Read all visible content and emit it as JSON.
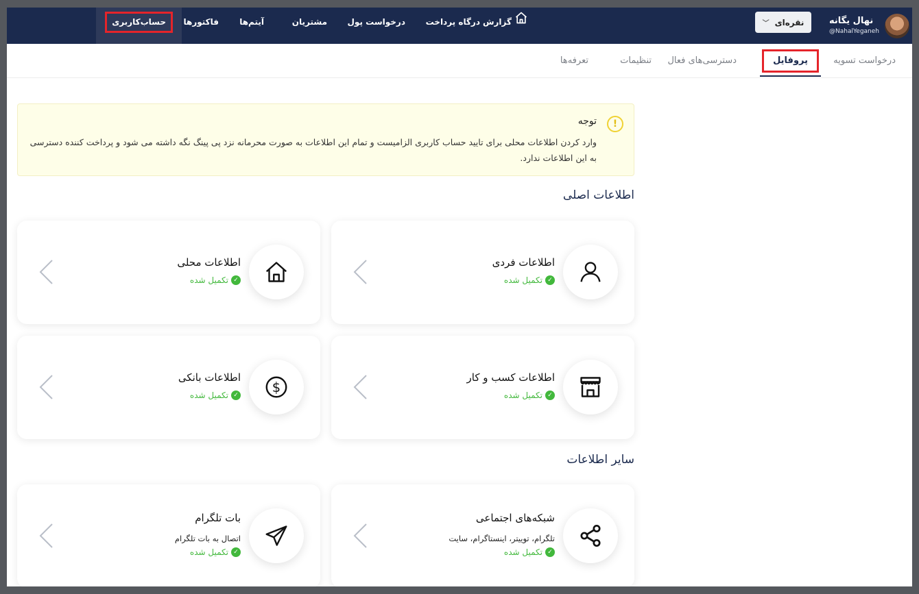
{
  "user": {
    "name": "نهال یگانه",
    "handle": "@NahalYeganeh"
  },
  "currency": {
    "label": "نقره‌ای"
  },
  "nav": [
    {
      "id": "report",
      "label": "گزارش"
    },
    {
      "id": "gateway",
      "label": "درگاه پرداخت"
    },
    {
      "id": "money-request",
      "label": "درخواست پول"
    },
    {
      "id": "customers",
      "label": "مشتریان"
    },
    {
      "id": "items",
      "label": "آیتم‌ها"
    },
    {
      "id": "invoices",
      "label": "فاکتورها"
    },
    {
      "id": "account",
      "label": "حساب‌کاربری"
    }
  ],
  "subtabs": [
    {
      "id": "settlement",
      "label": "درخواست تسویه"
    },
    {
      "id": "profile",
      "label": "پروفایل"
    },
    {
      "id": "active-access",
      "label": "دسترسی‌های فعال"
    },
    {
      "id": "settings",
      "label": "تنظیمات"
    },
    {
      "id": "tariffs",
      "label": "تعرفه‌ها"
    }
  ],
  "notice": {
    "title": "توجه",
    "body": "وارد کردن اطلاعات محلی برای تایید حساب کاربری الزامیست و تمام این اطلاعات به صورت محرمانه نزد پی پینگ نگه داشته می شود و پرداخت کننده دسترسی به این اطلاعات ندارد."
  },
  "sections": {
    "main": "اطلاعات اصلی",
    "other": "سایر اطلاعات"
  },
  "status_done": "تکمیل شده",
  "cards": {
    "personal": {
      "title": "اطلاعات فردی",
      "icon": "user-icon"
    },
    "local": {
      "title": "اطلاعات محلی",
      "icon": "home-icon"
    },
    "business": {
      "title": "اطلاعات کسب و کار",
      "icon": "store-icon"
    },
    "bank": {
      "title": "اطلاعات بانکی",
      "icon": "dollar-icon"
    },
    "social": {
      "title": "شبکه‌های اجتماعی",
      "subtitle": "تلگرام، توییتر، اینستاگرام، سایت",
      "icon": "share-icon"
    },
    "telegram": {
      "title": "بات تلگرام",
      "subtitle": "اتصال به بات تلگرام",
      "icon": "send-icon"
    }
  },
  "colors": {
    "nav_bg": "#1b2a4e",
    "success": "#42b83c",
    "highlight": "#e5242a",
    "notice_bg": "#fefee8"
  }
}
